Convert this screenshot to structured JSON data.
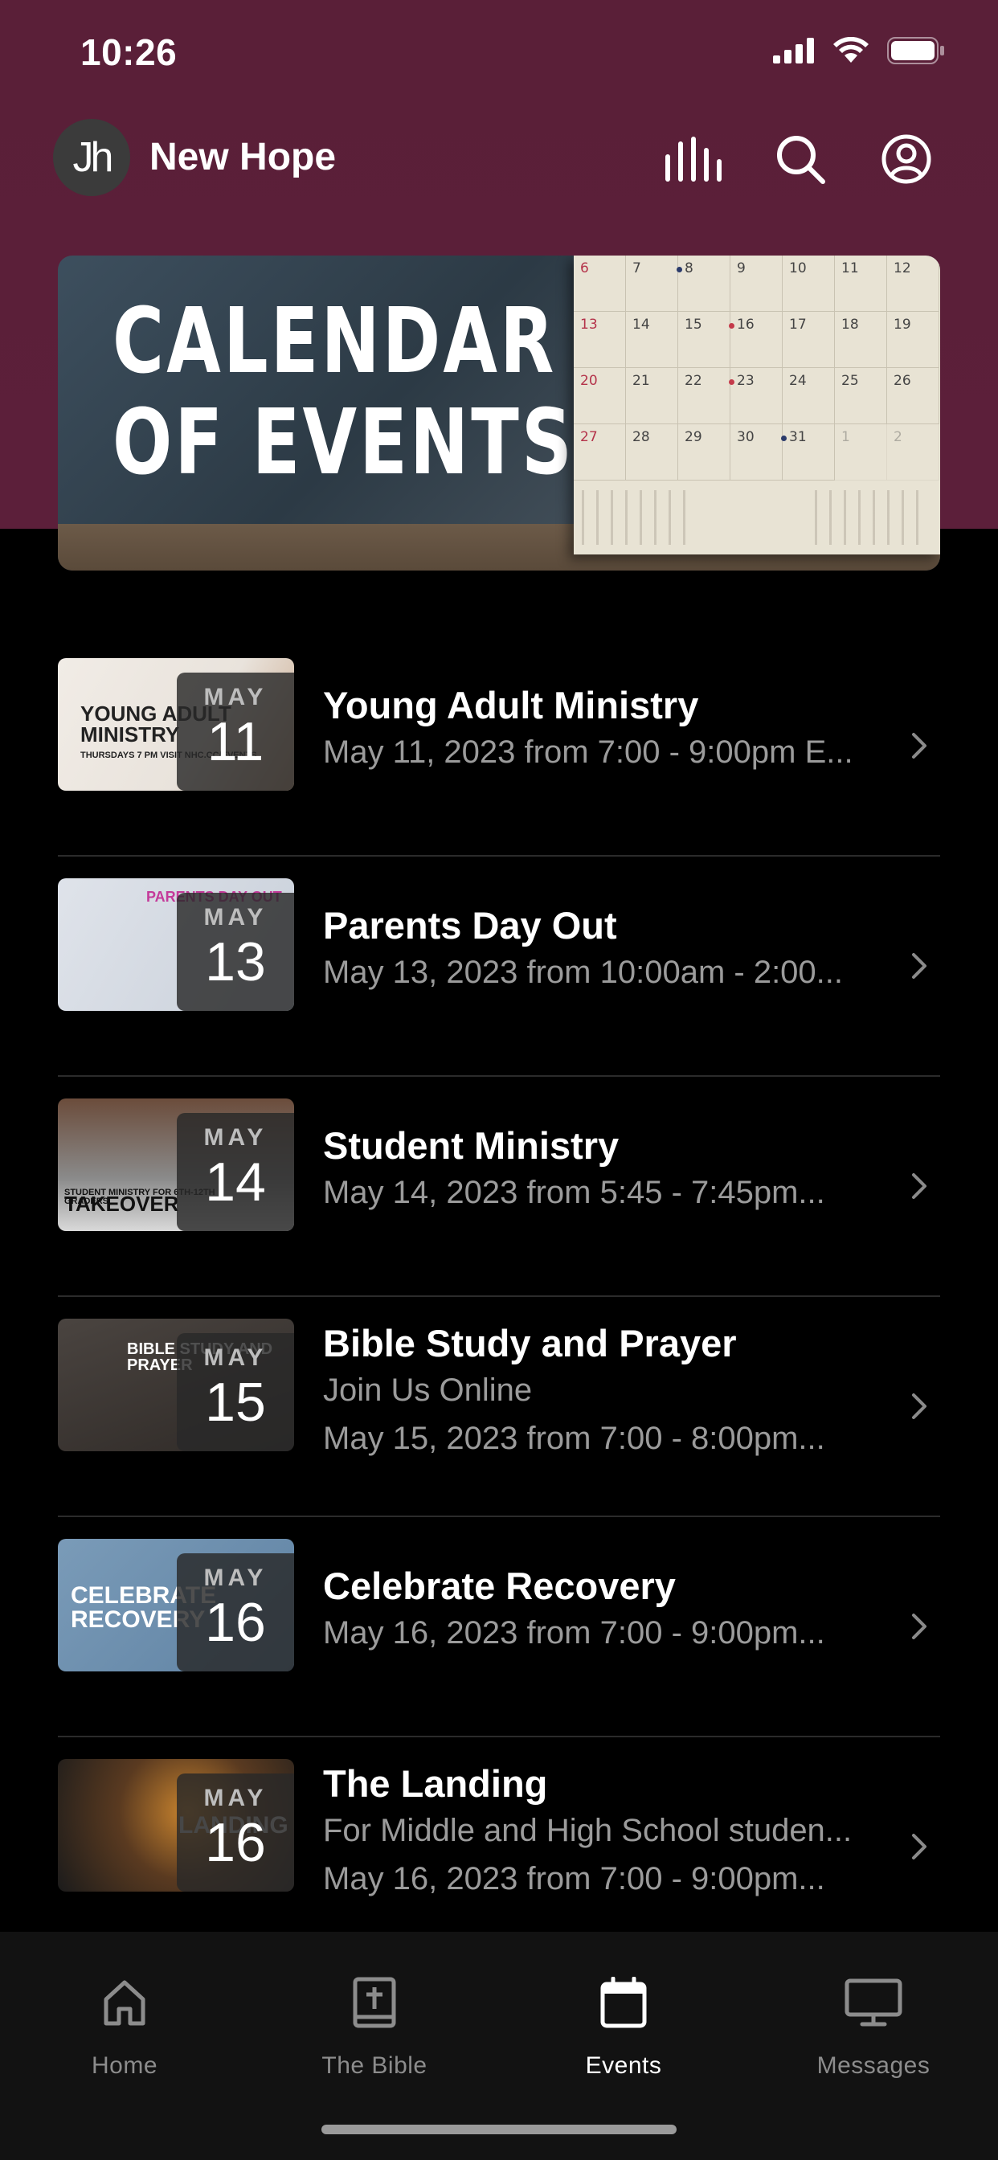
{
  "status_bar": {
    "time": "10:26"
  },
  "header": {
    "avatar_text": "Jh",
    "app_name": "New Hope",
    "icons": [
      "podcast-bars-icon",
      "search-icon",
      "profile-icon"
    ]
  },
  "hero": {
    "title_line1": "CALENDAR",
    "title_line2": "OF EVENTS",
    "calendar_numbers": [
      [
        "6",
        "7",
        "8",
        "9",
        "10",
        "11",
        "12"
      ],
      [
        "13",
        "14",
        "15",
        "16",
        "17",
        "18",
        "19"
      ],
      [
        "20",
        "21",
        "22",
        "23",
        "24",
        "25",
        "26"
      ],
      [
        "27",
        "28",
        "29",
        "30",
        "31",
        "1",
        "2"
      ]
    ]
  },
  "events": [
    {
      "title": "Young Adult Ministry",
      "lines": [
        "May 11, 2023 from 7:00 - 9:00pm E..."
      ],
      "month": "MAY",
      "day": "11",
      "thumb_text": "YOUNG ADULT MINISTRY",
      "thumb_sub": "THURSDAYS 7 PM  VISIT NHC.CC/EVENTS"
    },
    {
      "title": "Parents Day Out",
      "lines": [
        "May 13, 2023 from 10:00am - 2:00..."
      ],
      "month": "MAY",
      "day": "13",
      "thumb_text": "PARENTS DAY OUT",
      "thumb_sub": ""
    },
    {
      "title": "Student Ministry",
      "lines": [
        "May 14, 2023 from 5:45 - 7:45pm..."
      ],
      "month": "MAY",
      "day": "14",
      "thumb_text": "TAKEOVER",
      "thumb_sub": "STUDENT MINISTRY FOR 6TH-12TH GRADERS"
    },
    {
      "title": "Bible Study and Prayer",
      "lines": [
        "Join Us Online",
        "May 15, 2023 from 7:00 - 8:00pm..."
      ],
      "month": "MAY",
      "day": "15",
      "thumb_text": "BIBLE STUDY AND PRAYER",
      "thumb_sub": ""
    },
    {
      "title": "Celebrate Recovery",
      "lines": [
        "May 16, 2023 from 7:00 - 9:00pm..."
      ],
      "month": "MAY",
      "day": "16",
      "thumb_text": "CELEBRATE RECOVERY",
      "thumb_sub": ""
    },
    {
      "title": "The Landing",
      "lines": [
        "For Middle and High School studen...",
        "May 16, 2023 from 7:00 - 9:00pm..."
      ],
      "month": "MAY",
      "day": "16",
      "thumb_text": "LANDING",
      "thumb_sub": ""
    }
  ],
  "tab_bar": {
    "tabs": [
      {
        "label": "Home",
        "icon": "home-icon",
        "active": false
      },
      {
        "label": "The Bible",
        "icon": "bible-icon",
        "active": false
      },
      {
        "label": "Events",
        "icon": "calendar-icon",
        "active": true
      },
      {
        "label": "Messages",
        "icon": "tv-icon",
        "active": false
      }
    ]
  },
  "colors": {
    "header_maroon": "#5c1f3a",
    "background": "#000000",
    "secondary_text": "#9b9b9b",
    "tab_inactive": "#8c8c8c"
  }
}
